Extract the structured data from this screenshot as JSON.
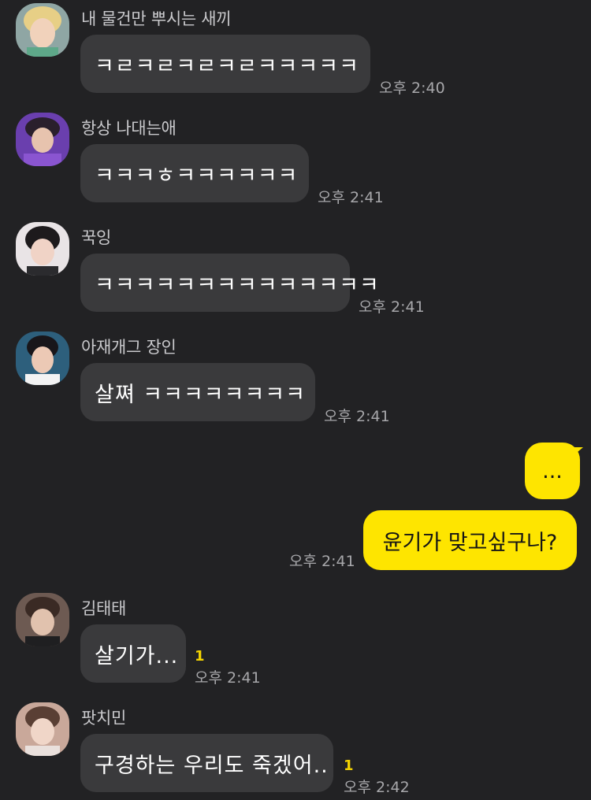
{
  "colors": {
    "background": "#222224",
    "incoming_bubble": "#3a3a3c",
    "outgoing_bubble": "#fee500",
    "unread": "#f5d400",
    "timestamp": "#a7a7aa"
  },
  "messages": [
    {
      "sender": "내 물건만 뿌시는 새끼",
      "text": "ㅋㄹㅋㄹㅋㄹㅋㄹㅋㅋㅋㅋㅋ",
      "time": "오후 2:40"
    },
    {
      "sender": "항상 나대는애",
      "text": "ㅋㅋㅋㅎㅋㅋㅋㅋㅋㅋ",
      "time": "오후 2:41"
    },
    {
      "sender": "꾹잉",
      "text": "ㅋㅋㅋㅋㅋㅋㅋㅋㅋㅋㅋㅋㅋㅋ",
      "time": "오후 2:41"
    },
    {
      "sender": "아재개그 장인",
      "text": "살쪄 ㅋㅋㅋㅋㅋㅋㅋㅋ",
      "time": "오후 2:41"
    },
    {
      "sender": "김태태",
      "text": "살기가...",
      "time": "오후 2:41",
      "unread": "1"
    },
    {
      "sender": "팟치민",
      "text": "구경하는 우리도 죽겠어..",
      "time": "오후 2:42",
      "unread": "1"
    }
  ],
  "my_messages": [
    {
      "text": "..."
    },
    {
      "text": "윤기가 맞고싶구나?",
      "time": "오후 2:41"
    }
  ]
}
